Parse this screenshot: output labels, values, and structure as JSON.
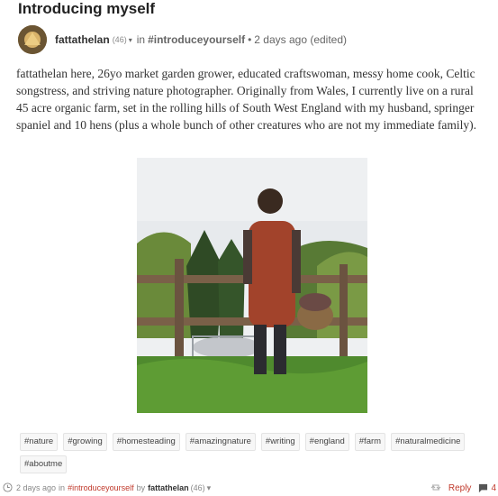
{
  "post": {
    "title": "Introducing myself",
    "author": "fattathelan",
    "author_rep": "(46)",
    "in_label": "in",
    "community": "#introduceyourself",
    "time": "2 days ago (edited)",
    "body": "fattathelan here, 26yo market garden grower, educated craftswoman, messy home cook, Celtic songstress, and striving nature photographer. Originally from Wales, I currently live on a rural 45 acre organic farm, set in the rolling hills of South West England with my husband, springer spaniel and 10 hens (plus a whole bunch of other creatures who are not my immediate family)."
  },
  "tags": [
    "#nature",
    "#growing",
    "#homesteading",
    "#amazingnature",
    "#writing",
    "#england",
    "#farm",
    "#naturalmedicine",
    "#aboutme"
  ],
  "footer": {
    "time": "2 days ago",
    "in_label": "in",
    "community": "#introduceyourself",
    "by_label": "by",
    "author": "fattathelan",
    "author_rep": "(46)",
    "reply_label": "Reply",
    "comment_count": "4"
  },
  "icons": {
    "caret": "chevron-down-icon",
    "clock": "clock-icon",
    "resteem": "resteem-icon",
    "comments": "comment-icon"
  },
  "colors": {
    "link": "#c0392b",
    "muted": "#888888"
  }
}
